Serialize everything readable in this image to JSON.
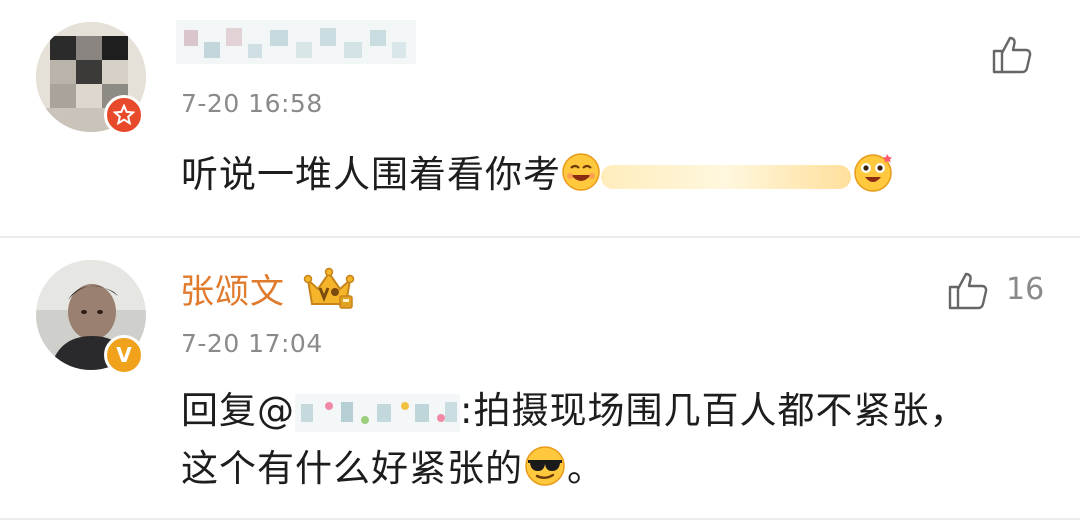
{
  "comments": [
    {
      "name": "",
      "time": "7-20 16:58",
      "text": "听说一堆人围着看你考",
      "like_count": "",
      "badge_icon": "star-badge-icon",
      "emojis": [
        "laughing-emoji-icon",
        "excited-emoji-icon"
      ]
    },
    {
      "name": "张颂文",
      "time": "7-20 17:04",
      "reply_prefix": "回复",
      "mention_at": "@",
      "text_line1": ":拍摄现场围几百人都不紧张，",
      "text_line2": "这个有什么好紧张的",
      "text_line2_end": "。",
      "like_count": "16",
      "badge_icon": "verified-v-badge-icon",
      "badge_letter": "V",
      "crown_icon": "crown-vip-icon",
      "emojis": [
        "cool-sunglasses-emoji-icon"
      ]
    }
  ],
  "colors": {
    "username": "#e07a2d",
    "timestamp": "#8a8a8a",
    "text": "#1d1d1d",
    "badge_red": "#e8492b",
    "badge_orange": "#f0a21c"
  }
}
